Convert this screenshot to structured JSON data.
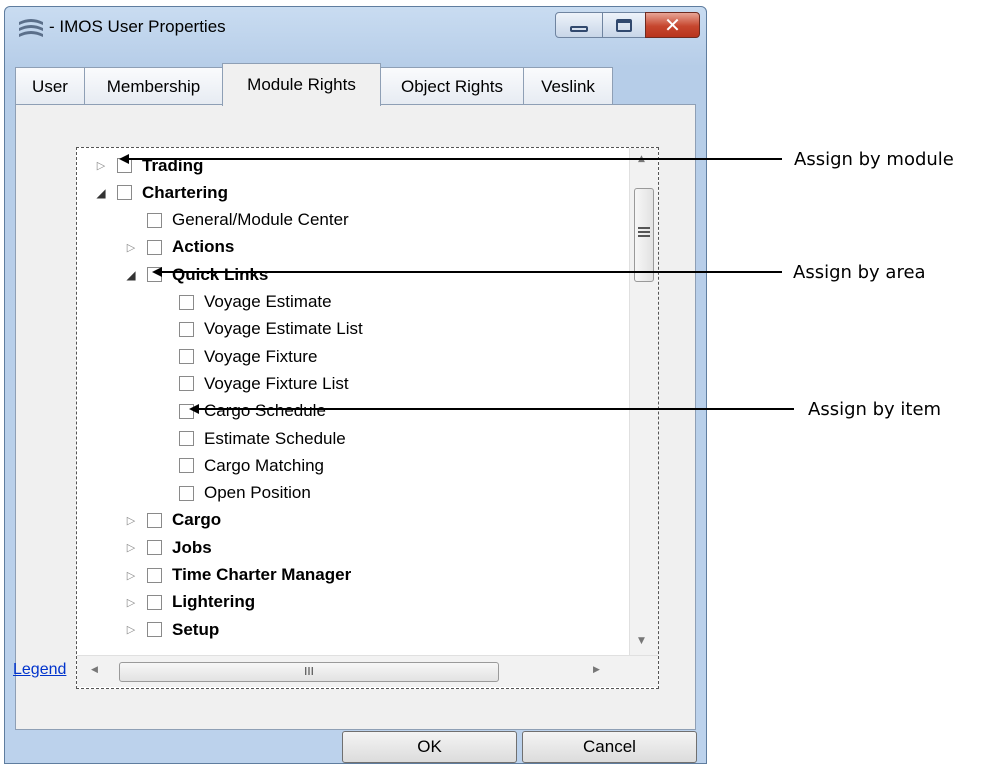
{
  "window": {
    "title": "- IMOS User Properties",
    "close_glyph": "✕"
  },
  "tabs": [
    {
      "label": "User"
    },
    {
      "label": "Membership"
    },
    {
      "label": "Module Rights",
      "active": true
    },
    {
      "label": "Object Rights"
    },
    {
      "label": "Veslink"
    }
  ],
  "tree": [
    {
      "label": "Trading",
      "bold": true,
      "expander": "collapsed",
      "level": 0
    },
    {
      "label": "Chartering",
      "bold": true,
      "expander": "expanded",
      "level": 0
    },
    {
      "label": "General/Module Center",
      "bold": false,
      "expander": "none",
      "level": 1
    },
    {
      "label": "Actions",
      "bold": true,
      "expander": "collapsed",
      "level": 1
    },
    {
      "label": "Quick Links",
      "bold": true,
      "expander": "expanded",
      "level": 1
    },
    {
      "label": "Voyage Estimate",
      "bold": false,
      "expander": "none",
      "level": 2
    },
    {
      "label": "Voyage Estimate List",
      "bold": false,
      "expander": "none",
      "level": 2
    },
    {
      "label": "Voyage Fixture",
      "bold": false,
      "expander": "none",
      "level": 2
    },
    {
      "label": "Voyage Fixture List",
      "bold": false,
      "expander": "none",
      "level": 2
    },
    {
      "label": "Cargo Schedule",
      "bold": false,
      "expander": "none",
      "level": 2
    },
    {
      "label": "Estimate Schedule",
      "bold": false,
      "expander": "none",
      "level": 2
    },
    {
      "label": "Cargo Matching",
      "bold": false,
      "expander": "none",
      "level": 2
    },
    {
      "label": "Open Position",
      "bold": false,
      "expander": "none",
      "level": 2
    },
    {
      "label": "Cargo",
      "bold": true,
      "expander": "collapsed",
      "level": 1
    },
    {
      "label": "Jobs",
      "bold": true,
      "expander": "collapsed",
      "level": 1
    },
    {
      "label": "Time Charter Manager",
      "bold": true,
      "expander": "collapsed",
      "level": 1
    },
    {
      "label": "Lightering",
      "bold": true,
      "expander": "collapsed",
      "level": 1
    },
    {
      "label": "Setup",
      "bold": true,
      "expander": "collapsed",
      "level": 1
    }
  ],
  "scrollbar": {
    "h_thumb_grip": "III"
  },
  "legend_link": "Legend",
  "buttons": {
    "ok": "OK",
    "cancel": "Cancel"
  },
  "annotations": {
    "module": "Assign by module",
    "area": "Assign by area",
    "item": "Assign by item"
  },
  "colors": {
    "link": "#0033cc",
    "close_button": "#c6462e",
    "window_frame": "#bcd2ec"
  }
}
